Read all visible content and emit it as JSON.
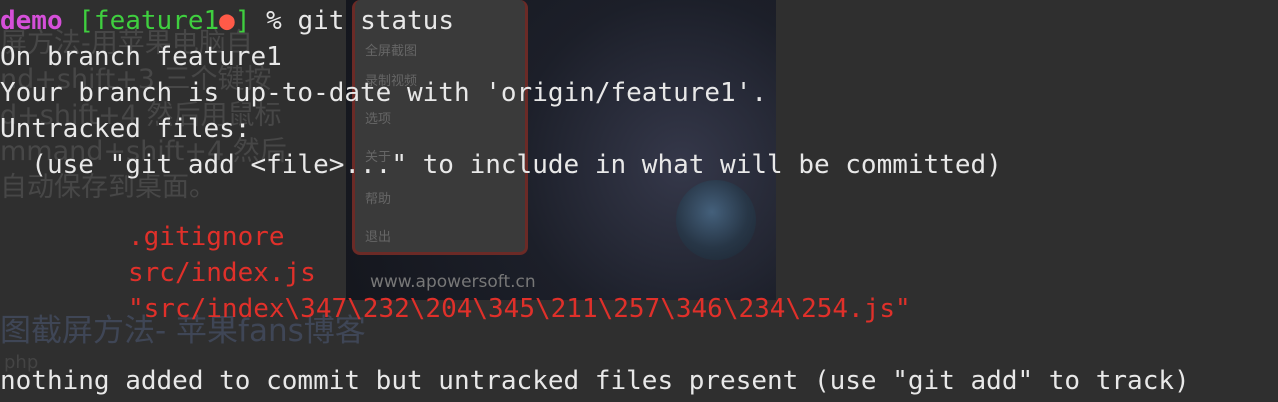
{
  "background": {
    "ghost_lines": [
      "屏方法-用苹果电脑自",
      "nd+shift+3 三个键按",
      "d+shift+4 然后用鼠标",
      "mmand+shift+4 然后",
      "自动保存到桌面。"
    ],
    "heading": "图截屏方法- 苹果fans博客",
    "small_text": "php",
    "watermark": "www.apowersoft.cn",
    "menu_items": [
      "全屏截图",
      "录制视频",
      "选项",
      "关于",
      "帮助",
      "退出"
    ]
  },
  "terminal": {
    "prompt": {
      "user": "demo",
      "branch": "[feature1",
      "dirty_marker": "●",
      "branch_close": "]",
      "symbol": "%",
      "command": "git status"
    },
    "output": [
      "On branch feature1",
      "Your branch is up-to-date with 'origin/feature1'.",
      "Untracked files:",
      "  (use \"git add <file>...\" to include in what will be committed)"
    ],
    "untracked_files": [
      ".gitignore",
      "src/index.js",
      "\"src/index\\347\\232\\204\\345\\211\\257\\346\\234\\254.js\""
    ],
    "footer": "nothing added to commit but untracked files present (use \"git add\" to track)"
  },
  "colors": {
    "user": "#d54fd9",
    "branch": "#3fcf3f",
    "dirty_marker": "#ff5a48",
    "untracked": "#e0302a",
    "text": "#e8e8e8",
    "background": "#2f2f2f"
  }
}
